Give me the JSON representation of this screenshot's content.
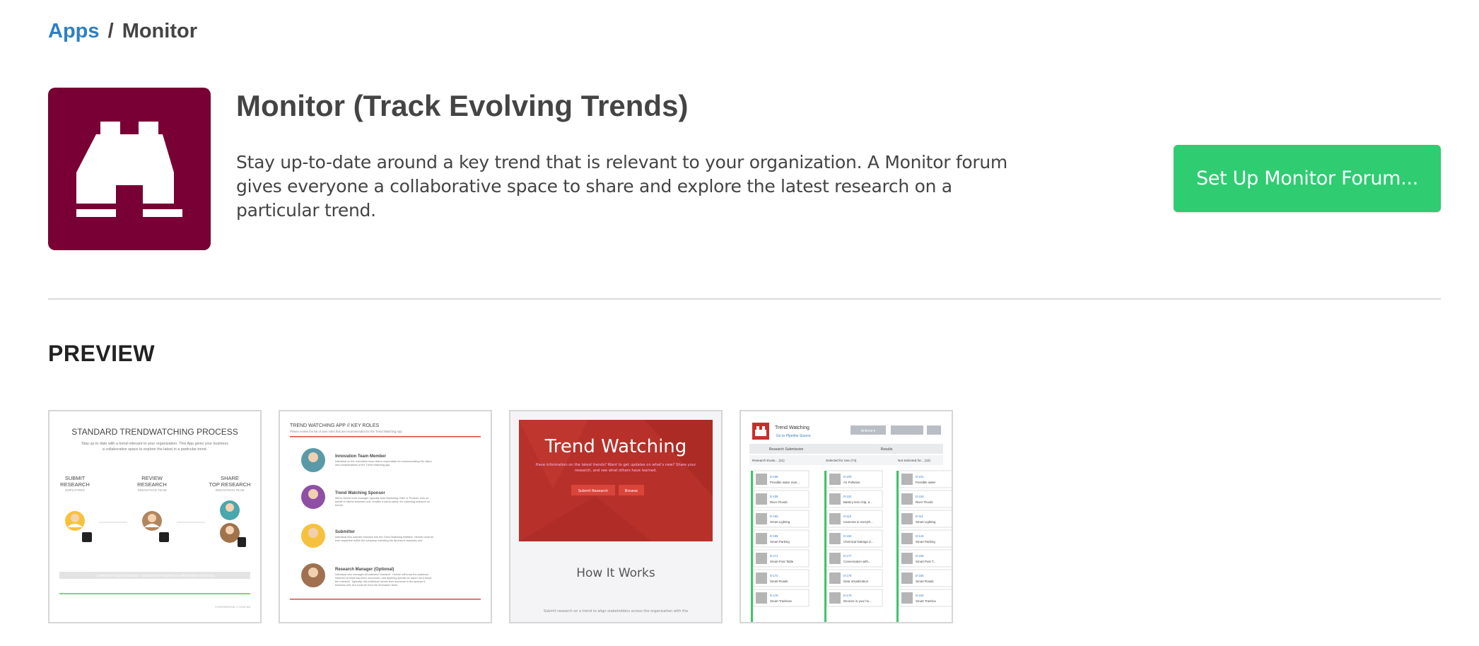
{
  "breadcrumb": {
    "root": "Apps",
    "separator": "/",
    "current": "Monitor"
  },
  "app": {
    "icon": "binoculars-icon",
    "icon_bg": "#780035",
    "title": "Monitor (Track Evolving Trends)",
    "description": "Stay up-to-date around a key trend that is relevant to your organization. A Monitor forum gives everyone a collaborative space to share and explore the latest research on a particular trend.",
    "setup_label": "Set Up Monitor Forum..."
  },
  "colors": {
    "link": "#2f7fc1",
    "accent": "#2fcc72",
    "text": "#444444",
    "trend_red": "#b8302a"
  },
  "preview": {
    "heading": "PREVIEW",
    "thumb1": {
      "title": "STANDARD TRENDWATCHING PROCESS",
      "subtitle_1": "Stay up to date with a trend relevant to your organization. This App gives your business",
      "subtitle_2": "a collaborative space to explore the latest in a particular trend.",
      "step1": [
        "SUBMIT",
        "RESEARCH",
        "EMPLOYEES"
      ],
      "step2": [
        "REVIEW",
        "RESEARCH",
        "INNOVATION TEAM"
      ],
      "step3": [
        "SHARE",
        "TOP RESEARCH",
        "INNOVATION TEAM"
      ],
      "footer": "COMMUNITY ENGAGEMENT  •  SUBMITTER FEEDBACK  •  PROGRESS UPDATES",
      "corner": "CONFIDENTIAL © 2016 IMI"
    },
    "thumb2": {
      "header": "TREND WATCHING APP // KEY ROLES",
      "intro": "Please review the list of user roles that are recommended for the Trend Watching App.",
      "roles": [
        {
          "name": "Innovation Team Member",
          "text": [
            "Individual on the Innovation team that is responsible for communicating the vision",
            "and considerations of the Trend Watching app."
          ]
        },
        {
          "name": "Trend Watching Sponsor",
          "text": [
            "Mid to Senior level manager, typically from Marketing, R&D or Product, who on",
            "behalf of his/her business unit, creates a call-to-action for collecting research on",
            "trends."
          ]
        },
        {
          "name": "Submitter",
          "text": [
            "Individual who submits research into the Trend Watching initiative. He/she could be",
            "from anywhere within the company, including the Sponsor's business unit."
          ]
        },
        {
          "name": "Research Manager (Optional)",
          "text": [
            "Individual who manages all collected 'research'. He/she will know the audience",
            "informed of what has been uncovered, and anything special for report via a result",
            "the research. Typically, this individual comes from someone in the sponsor's",
            "business unit, but could be from the Innovation team."
          ]
        }
      ]
    },
    "thumb3": {
      "hero_title": "Trend Watching",
      "hero_text_1": "Have information on the latest trends? Want to get updates on what's new? Share your",
      "hero_text_2": "research, and see what others have learned.",
      "submit_label": "Submit Research",
      "browse_label": "Browse",
      "section_title": "How It Works",
      "section_text": "Submit research on a trend to align stakeholders across the organization with the"
    },
    "thumb4": {
      "app_title": "Trend Watching",
      "back_link": "Go to Pipeline Source",
      "actions_label": "Actions ▾",
      "group_left": "Research Submission",
      "group_right": "Results",
      "columns": [
        "Research Evalu...  (21)",
        "Selected for Use (74)",
        "Not Selected for...  (22)"
      ],
      "col1": [
        [
          "D-106",
          "Possible water man..."
        ],
        [
          "D-109",
          "River Floods"
        ],
        [
          "D-160",
          "Smart Lighting"
        ],
        [
          "D-165",
          "Smart Parking"
        ],
        [
          "D-171",
          "Smart Post Table"
        ],
        [
          "D-172",
          "Smart Roads"
        ],
        [
          "D-175",
          "Smart Trashcan"
        ]
      ],
      "col2": [
        [
          "D-100",
          "Air Pollution"
        ],
        [
          "D-102",
          "Battery less chip, a..."
        ],
        [
          "D-115",
          "Cameras in everyth..."
        ],
        [
          "D-150",
          "Chemical leakage d..."
        ],
        [
          "D-177",
          "Conversation with..."
        ],
        [
          "D-178",
          "Data Visualization"
        ],
        [
          "D-179",
          "Devices in your ho..."
        ]
      ],
      "col3": [
        [
          "D-101",
          "Possible water"
        ],
        [
          "D-104",
          "River Floods"
        ],
        [
          "D-111",
          "Smart Lighting"
        ],
        [
          "D-143",
          "Smart Parking"
        ],
        [
          "D-156",
          "Smart Post T..."
        ],
        [
          "D-160",
          "Smart Roads"
        ],
        [
          "D-163",
          "Smart Trashca"
        ]
      ]
    }
  }
}
